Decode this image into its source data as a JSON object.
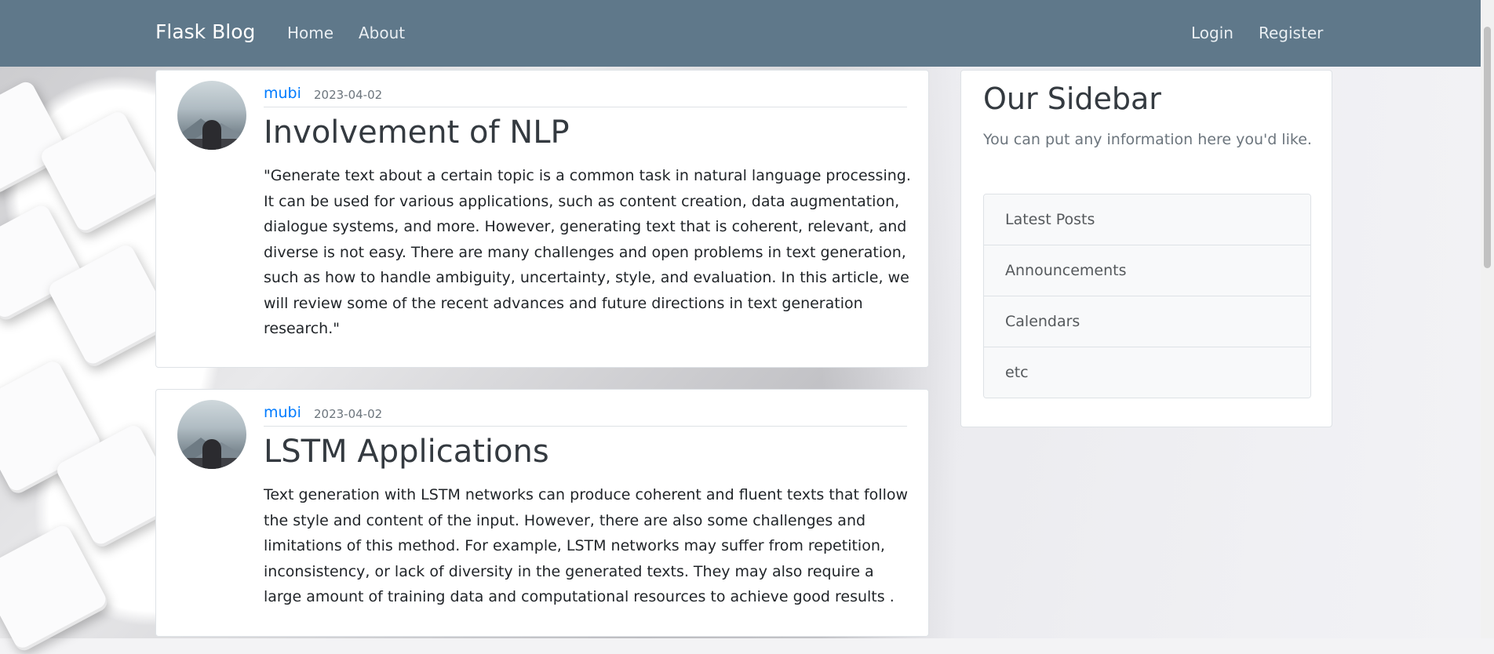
{
  "navbar": {
    "brand": "Flask Blog",
    "links_left": [
      "Home",
      "About"
    ],
    "links_right": [
      "Login",
      "Register"
    ]
  },
  "posts": [
    {
      "author": "mubi",
      "date": "2023-04-02",
      "title": "Involvement of NLP",
      "content": "\"Generate text about a certain topic is a common task in natural language processing. It can be used for various applications, such as content creation, data augmentation, dialogue systems, and more. However, generating text that is coherent, relevant, and diverse is not easy. There are many challenges and open problems in text generation, such as how to handle ambiguity, uncertainty, style, and evaluation. In this article, we will review some of the recent advances and future directions in text generation research.\""
    },
    {
      "author": "mubi",
      "date": "2023-04-02",
      "title": "LSTM Applications",
      "content": "Text generation with LSTM networks can produce coherent and fluent texts that follow the style and content of the input. However, there are also some challenges and limitations of this method. For example, LSTM networks may suffer from repetition, inconsistency, or lack of diversity in the generated texts. They may also require a large amount of training data and computational resources to achieve good results ."
    }
  ],
  "sidebar": {
    "title": "Our Sidebar",
    "text": "You can put any information here you'd like.",
    "items": [
      "Latest Posts",
      "Announcements",
      "Calendars",
      "etc"
    ]
  },
  "colors": {
    "navbar": "#5f788a",
    "author_link": "#007bff"
  }
}
